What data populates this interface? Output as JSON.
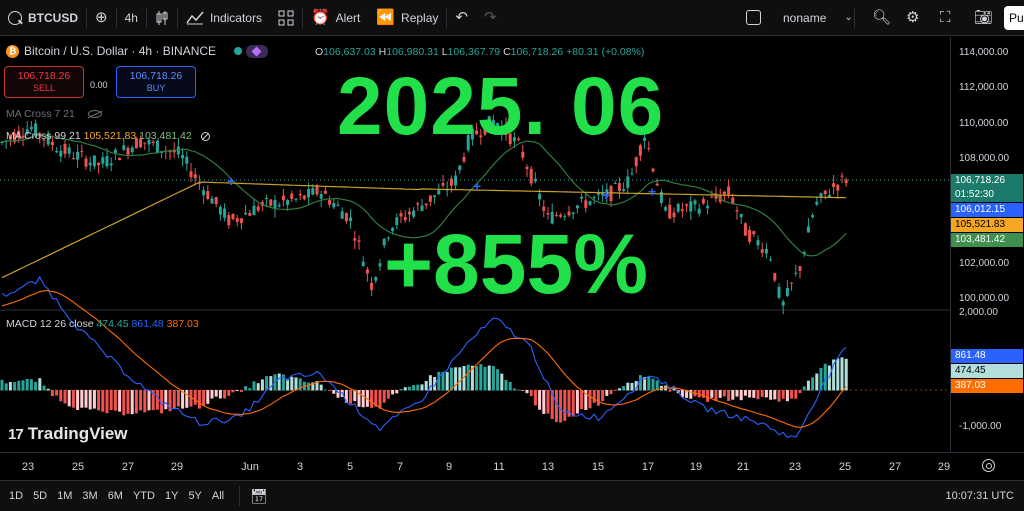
{
  "toolbar": {
    "symbol": "BTCUSD",
    "interval": "4h",
    "indicators": "Indicators",
    "alert": "Alert",
    "replay": "Replay",
    "layout_name": "noname",
    "publish": "Pu"
  },
  "legend": {
    "title": "Bitcoin / U.S. Dollar · 4h · BINANCE",
    "open_label": "O",
    "open": "106,637.03",
    "high_label": "H",
    "high": "106,980.31",
    "low_label": "L",
    "low": "106,367.79",
    "close_label": "C",
    "close": "106,718.26",
    "change": "+80.31 (+0.08%)"
  },
  "trade": {
    "sell_price": "106,718.26",
    "sell_label": "SELL",
    "spread": "0.00",
    "buy_price": "106,718.26",
    "buy_label": "BUY"
  },
  "indicators": {
    "ma1_label": "MA Cross 7 21",
    "ma2_label": "MA Cross 99 21",
    "ma2_v1": "105,521.83",
    "ma2_v2": "103,481.42",
    "macd_label": "MACD 12 26 close",
    "macd_hist": "474.45",
    "macd_line": "861.48",
    "macd_signal": "387.03"
  },
  "overlay": {
    "year": "2025. 06",
    "gain": "+855%"
  },
  "price_scale": {
    "ticks": [
      "114,000.00",
      "112,000.00",
      "110,000.00",
      "108,000.00",
      "102,000.00",
      "100,000.00"
    ],
    "last_price": "106,718.26",
    "countdown": "01:52:30",
    "tag_blue": "106,012.15",
    "tag_orange": "105,521.83",
    "tag_green": "103,481.42",
    "macd_ticks": [
      "2,000.00",
      "-1,000.00"
    ],
    "macd_tag_blue": "861.48",
    "macd_tag_teal": "474.45",
    "macd_tag_orange": "387.03"
  },
  "time_axis": [
    "23",
    "25",
    "27",
    "29",
    "Jun",
    "3",
    "5",
    "7",
    "9",
    "11",
    "13",
    "15",
    "17",
    "19",
    "21",
    "23",
    "25",
    "27",
    "29"
  ],
  "bottom": {
    "ranges": [
      "1D",
      "5D",
      "1M",
      "3M",
      "6M",
      "YTD",
      "1Y",
      "5Y",
      "All"
    ],
    "clock": "10:07:31 UTC"
  },
  "watermark": {
    "logo": "17",
    "name": "TradingView"
  },
  "colors": {
    "up": "#26a69a",
    "down": "#ef5350",
    "ma_short": "#2f7d3e",
    "ma_long": "#c9a227",
    "overlay": "#22e04a"
  },
  "chart_data": {
    "type": "candlestick",
    "price_range": [
      99300,
      115000
    ],
    "time_range": [
      "May 22",
      "Jun 29"
    ],
    "last_close": 106718.26,
    "macd_range": [
      -1400,
      2100
    ],
    "macd_line": 861.48,
    "macd_signal": 387.03,
    "macd_histogram": 474.45
  }
}
